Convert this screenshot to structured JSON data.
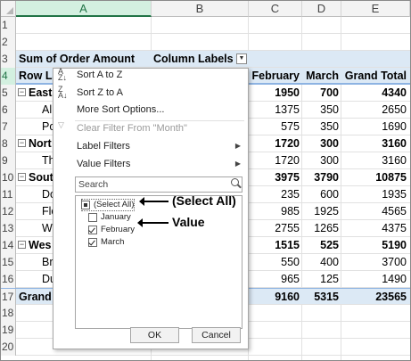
{
  "columns": [
    "A",
    "B",
    "C",
    "D",
    "E"
  ],
  "row_numbers": [
    "1",
    "2",
    "3",
    "4",
    "5",
    "6",
    "7",
    "8",
    "9",
    "10",
    "11",
    "12",
    "13",
    "14",
    "15",
    "16",
    "17",
    "18",
    "19",
    "20"
  ],
  "pivot": {
    "header_value_label": "Sum of Order Amount",
    "column_labels": "Column Labels",
    "row_labels": "Row La",
    "col_headers": [
      "February",
      "March",
      "Grand Total"
    ],
    "rows": [
      {
        "label": "East",
        "group": true,
        "feb": "1950",
        "mar": "700",
        "total": "4340"
      },
      {
        "label": "Al",
        "group": false,
        "feb": "1375",
        "mar": "350",
        "total": "2650"
      },
      {
        "label": "Po",
        "group": false,
        "feb": "575",
        "mar": "350",
        "total": "1690"
      },
      {
        "label": "Nort",
        "group": true,
        "feb": "1720",
        "mar": "300",
        "total": "3160"
      },
      {
        "label": "Th",
        "group": false,
        "feb": "1720",
        "mar": "300",
        "total": "3160"
      },
      {
        "label": "Sout",
        "group": true,
        "feb": "3975",
        "mar": "3790",
        "total": "10875"
      },
      {
        "label": "Do",
        "group": false,
        "feb": "235",
        "mar": "600",
        "total": "1935"
      },
      {
        "label": "Flo",
        "group": false,
        "feb": "985",
        "mar": "1925",
        "total": "4565"
      },
      {
        "label": "W",
        "group": false,
        "feb": "2755",
        "mar": "1265",
        "total": "4375"
      },
      {
        "label": "Wes",
        "group": true,
        "feb": "1515",
        "mar": "525",
        "total": "5190"
      },
      {
        "label": "Br",
        "group": false,
        "feb": "550",
        "mar": "400",
        "total": "3700"
      },
      {
        "label": "Du",
        "group": false,
        "feb": "965",
        "mar": "125",
        "total": "1490"
      }
    ],
    "grand": {
      "label": "Grand",
      "feb": "9160",
      "mar": "5315",
      "total": "23565"
    }
  },
  "menu": {
    "sort_az": "Sort A to Z",
    "sort_za": "Sort Z to A",
    "more_sort": "More Sort Options...",
    "clear_filter": "Clear Filter From \"Month\"",
    "label_filters": "Label Filters",
    "value_filters": "Value Filters",
    "search_placeholder": "Search",
    "items": [
      "(Select All)",
      "January",
      "February",
      "March"
    ],
    "ok": "OK",
    "cancel": "Cancel"
  },
  "callouts": {
    "select_all": "(Select All)",
    "value": "Value"
  },
  "colors": {
    "pivot_header_band": "#dce9f5",
    "accent": "#217346",
    "grid": "#e1e1e1"
  }
}
